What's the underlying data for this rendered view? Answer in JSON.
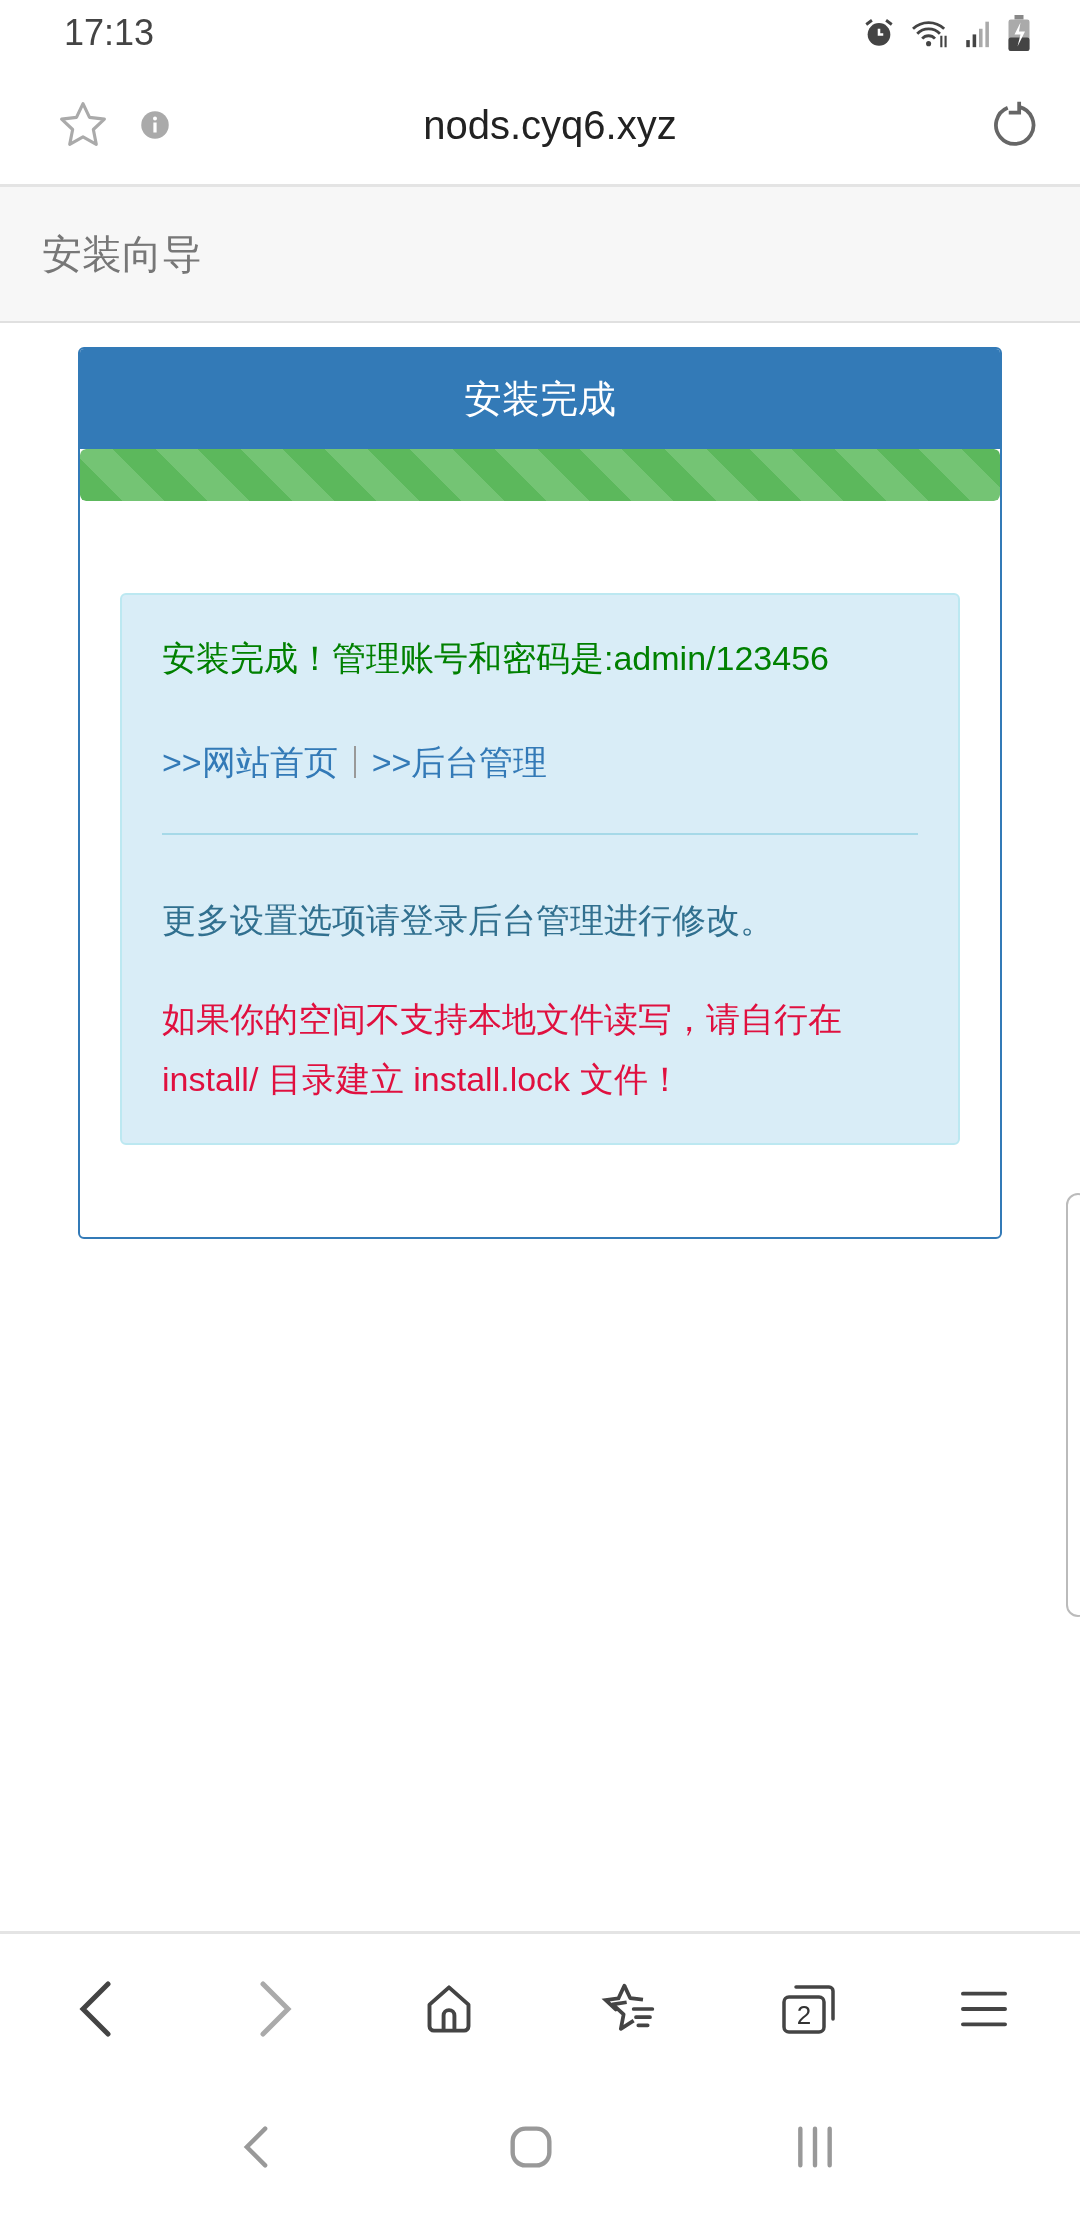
{
  "status_bar": {
    "time": "17:13"
  },
  "address_bar": {
    "url": "nods.cyq6.xyz"
  },
  "navbar": {
    "title": "安装向导"
  },
  "panel": {
    "title": "安装完成",
    "progress": {
      "level": 1
    },
    "alert": {
      "success_message": "安装完成！管理账号和密码是:admin/123456",
      "links": [
        {
          "label": ">>网站首页"
        },
        {
          "label": ">>后台管理"
        }
      ],
      "note": "更多设置选项请登录后台管理进行修改。",
      "warning": "如果你的空间不支持本地文件读写，请自行在install/ 目录建立 install.lock 文件！"
    }
  },
  "bottom_toolbar": {
    "tab_count": "2"
  }
}
